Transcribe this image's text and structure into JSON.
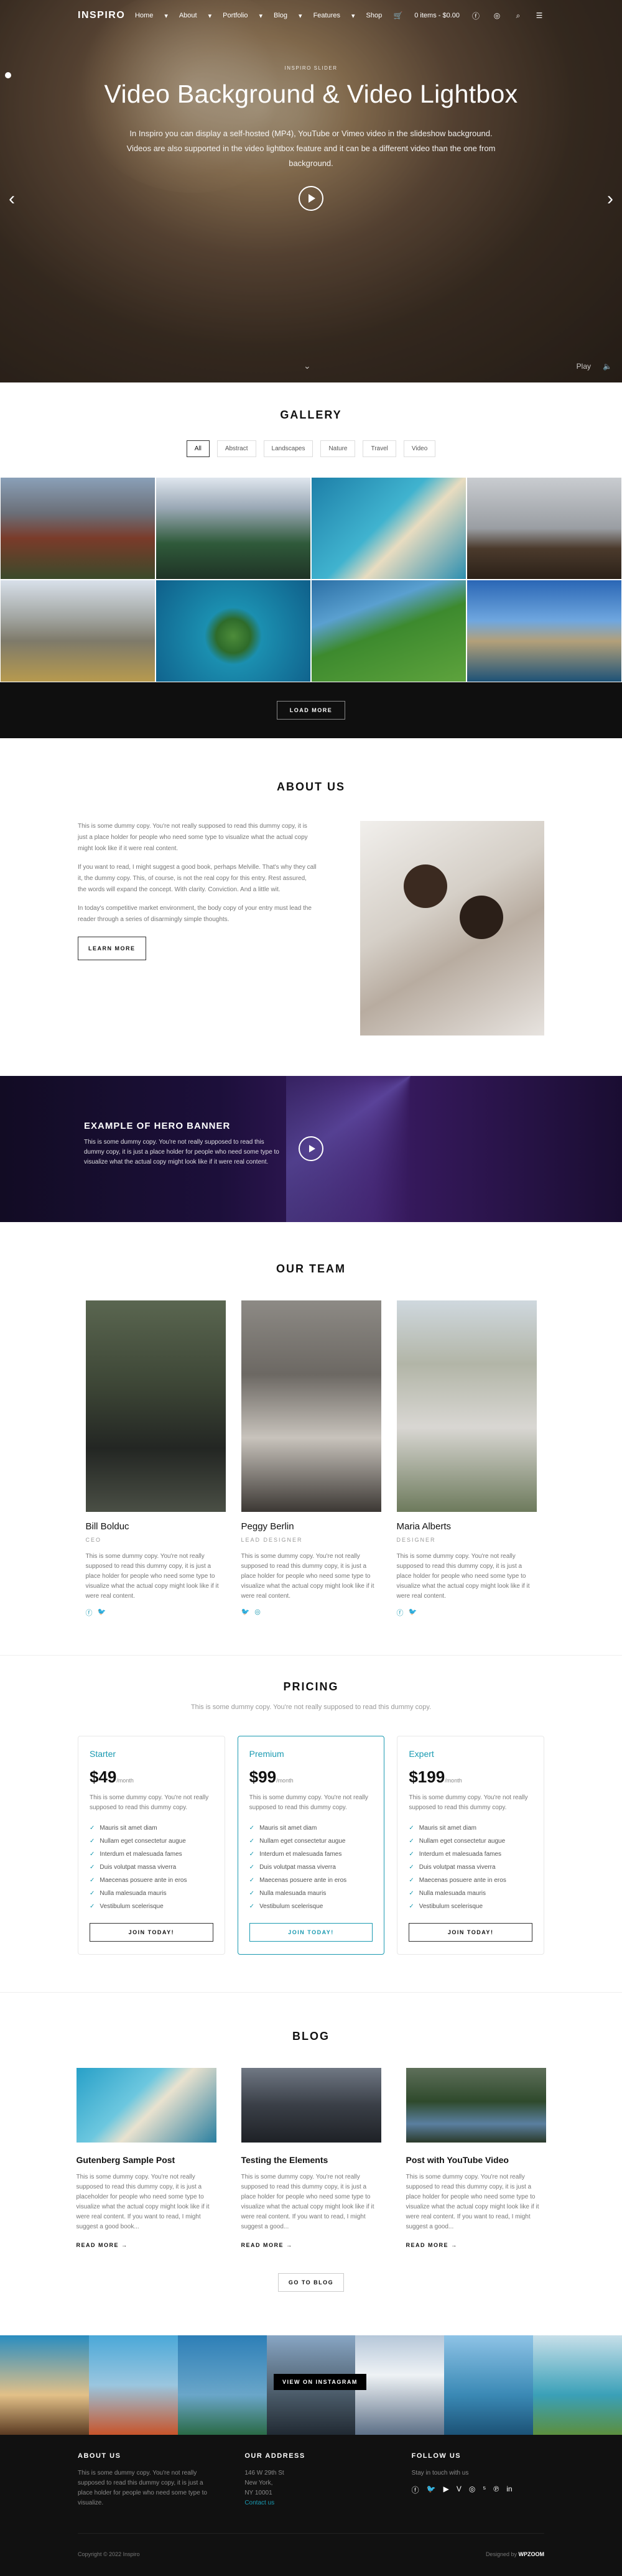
{
  "nav": {
    "logo": "INSPIRO",
    "items": [
      "Home",
      "About",
      "Portfolio",
      "Blog",
      "Features",
      "Shop"
    ],
    "cart": "0 items - $0.00"
  },
  "hero": {
    "eyebrow": "INSPIRO SLIDER",
    "title": "Video Background & Video Lightbox",
    "text": "In Inspiro you can display a self-hosted (MP4), YouTube or Vimeo video in the slideshow background. Videos are also supported in the video lightbox feature and it can be a different video than the one from background.",
    "play_label": "Play"
  },
  "gallery": {
    "title": "GALLERY",
    "filters": [
      "All",
      "Abstract",
      "Landscapes",
      "Nature",
      "Travel",
      "Video"
    ],
    "load_more": "LOAD MORE"
  },
  "about": {
    "title": "ABOUT US",
    "paragraphs": [
      "This is some dummy copy. You're not really supposed to read this dummy copy, it is just a place holder for people who need some type to visualize what the actual copy might look like if it were real content.",
      "If you want to read, I might suggest a good book, perhaps Melville. That's why they call it, the dummy copy. This, of course, is not the real copy for this entry. Rest assured, the words will expand the concept. With clarity. Conviction. And a little wit.",
      "In today's competitive market environment, the body copy of your entry must lead the reader through a series of disarmingly simple thoughts."
    ],
    "button": "LEARN MORE"
  },
  "banner": {
    "title": "EXAMPLE OF HERO BANNER",
    "text": "This is some dummy copy. You're not really supposed to read this dummy copy, it is just a place holder for people who need some type to visualize what the actual copy might look like if it were real content."
  },
  "team": {
    "title": "OUR TEAM",
    "members": [
      {
        "name": "Bill Bolduc",
        "role": "CEO",
        "bio": "This is some dummy copy. You're not really supposed to read this dummy copy, it is just a place holder for people who need some type to visualize what the actual copy might look like if it were real content."
      },
      {
        "name": "Peggy Berlin",
        "role": "LEAD DESIGNER",
        "bio": "This is some dummy copy. You're not really supposed to read this dummy copy, it is just a place holder for people who need some type to visualize what the actual copy might look like if it were real content."
      },
      {
        "name": "Maria Alberts",
        "role": "DESIGNER",
        "bio": "This is some dummy copy. You're not really supposed to read this dummy copy, it is just a place holder for people who need some type to visualize what the actual copy might look like if it were real content."
      }
    ]
  },
  "pricing": {
    "title": "PRICING",
    "subtitle": "This is some dummy copy. You're not really supposed to read this dummy copy.",
    "plans": [
      {
        "name": "Starter",
        "price": "$49",
        "period": "/month",
        "desc": "This is some dummy copy. You're not really supposed to read this dummy copy.",
        "features": [
          "Mauris sit amet diam",
          "Nullam eget consectetur augue",
          "Interdum et malesuada fames",
          "Duis volutpat massa viverra",
          "Maecenas posuere ante in eros",
          "Nulla malesuada mauris",
          "Vestibulum scelerisque"
        ],
        "button": "JOIN TODAY!"
      },
      {
        "name": "Premium",
        "price": "$99",
        "period": "/month",
        "desc": "This is some dummy copy. You're not really supposed to read this dummy copy.",
        "features": [
          "Mauris sit amet diam",
          "Nullam eget consectetur augue",
          "Interdum et malesuada fames",
          "Duis volutpat massa viverra",
          "Maecenas posuere ante in eros",
          "Nulla malesuada mauris",
          "Vestibulum scelerisque"
        ],
        "button": "JOIN TODAY!"
      },
      {
        "name": "Expert",
        "price": "$199",
        "period": "/month",
        "desc": "This is some dummy copy. You're not really supposed to read this dummy copy.",
        "features": [
          "Mauris sit amet diam",
          "Nullam eget consectetur augue",
          "Interdum et malesuada fames",
          "Duis volutpat massa viverra",
          "Maecenas posuere ante in eros",
          "Nulla malesuada mauris",
          "Vestibulum scelerisque"
        ],
        "button": "JOIN TODAY!"
      }
    ]
  },
  "blog": {
    "title": "BLOG",
    "posts": [
      {
        "title": "Gutenberg Sample Post",
        "excerpt": "This is some dummy copy. You're not really supposed to read this dummy copy, it is just a placeholder for people who need some type to visualize what the actual copy might look like if it were real content. If you want to read, I might suggest a good book..."
      },
      {
        "title": "Testing the Elements",
        "excerpt": "This is some dummy copy. You're not really supposed to read this dummy copy, it is just a place holder for people who need some type to visualize what the actual copy might look like if it were real content. If you want to read, I might suggest a good..."
      },
      {
        "title": "Post with YouTube Video",
        "excerpt": "This is some dummy copy. You're not really supposed to read this dummy copy, it is just a place holder for people who need some type to visualize what the actual copy might look like if it were real content. If you want to read, I might suggest a good..."
      }
    ],
    "read_more": "READ MORE →",
    "go_to_blog": "GO TO BLOG"
  },
  "instagram": {
    "caption": "VIEW ON INSTAGRAM"
  },
  "footer": {
    "about_title": "ABOUT US",
    "about_text": "This is some dummy copy. You're not really supposed to read this dummy copy, it is just a place holder for people who need some type to visualize.",
    "address_title": "OUR ADDRESS",
    "address_lines": [
      "146 W 29th St",
      "New York,",
      "NY 10001"
    ],
    "contact": "Contact us",
    "follow_title": "FOLLOW US",
    "follow_text": "Stay in touch with us",
    "copyright": "Copyright © 2022 Inspiro",
    "designed_prefix": "Designed by",
    "designed_brand": "WPZOOM"
  },
  "colors": {
    "accent": "#1a9ab1",
    "dark": "#111111"
  }
}
